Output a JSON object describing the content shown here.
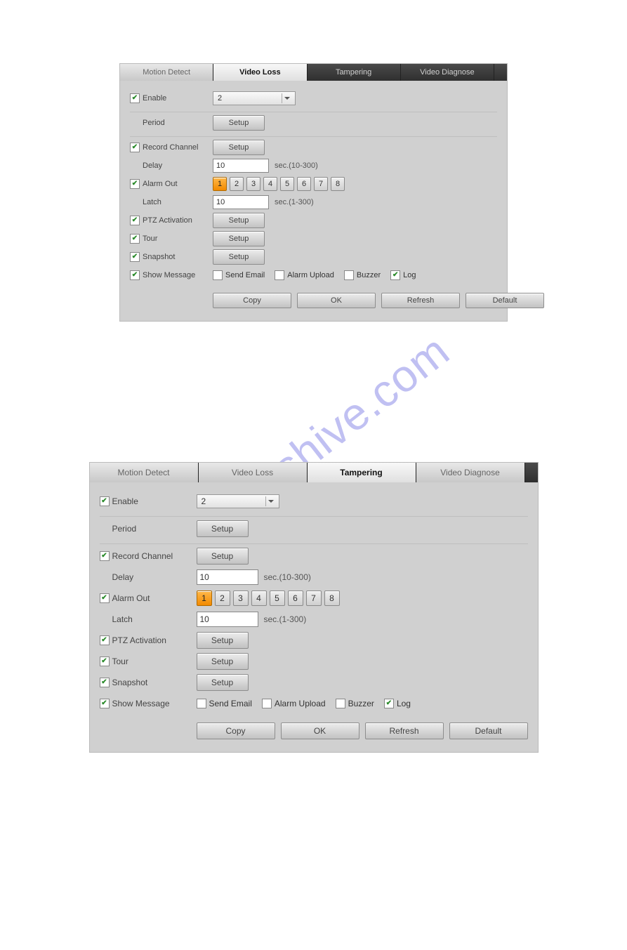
{
  "watermark": "manualshive.com",
  "tabs": [
    "Motion Detect",
    "Video Loss",
    "Tampering",
    "Video Diagnose"
  ],
  "panels": [
    {
      "activeTab": 1
    },
    {
      "activeTab": 2
    }
  ],
  "form": {
    "enable": {
      "label": "Enable",
      "checked": true,
      "channel": "2"
    },
    "period": {
      "label": "Period",
      "button": "Setup"
    },
    "record": {
      "label": "Record Channel",
      "checked": true,
      "button": "Setup"
    },
    "delay": {
      "label": "Delay",
      "value": "10",
      "hint": "sec.(10-300)"
    },
    "alarm": {
      "label": "Alarm Out",
      "checked": true,
      "selected": 1,
      "options": [
        "1",
        "2",
        "3",
        "4",
        "5",
        "6",
        "7",
        "8"
      ]
    },
    "latch": {
      "label": "Latch",
      "value": "10",
      "hint": "sec.(1-300)"
    },
    "ptz": {
      "label": "PTZ Activation",
      "checked": true,
      "button": "Setup"
    },
    "tour": {
      "label": "Tour",
      "checked": true,
      "button": "Setup"
    },
    "snap": {
      "label": "Snapshot",
      "checked": true,
      "button": "Setup"
    },
    "show": {
      "label": "Show Message",
      "checked": true,
      "opts": [
        {
          "label": "Send Email",
          "checked": false
        },
        {
          "label": "Alarm Upload",
          "checked": false
        },
        {
          "label": "Buzzer",
          "checked": false
        },
        {
          "label": "Log",
          "checked": true
        }
      ]
    },
    "footer": [
      "Copy",
      "OK",
      "Refresh",
      "Default"
    ]
  }
}
